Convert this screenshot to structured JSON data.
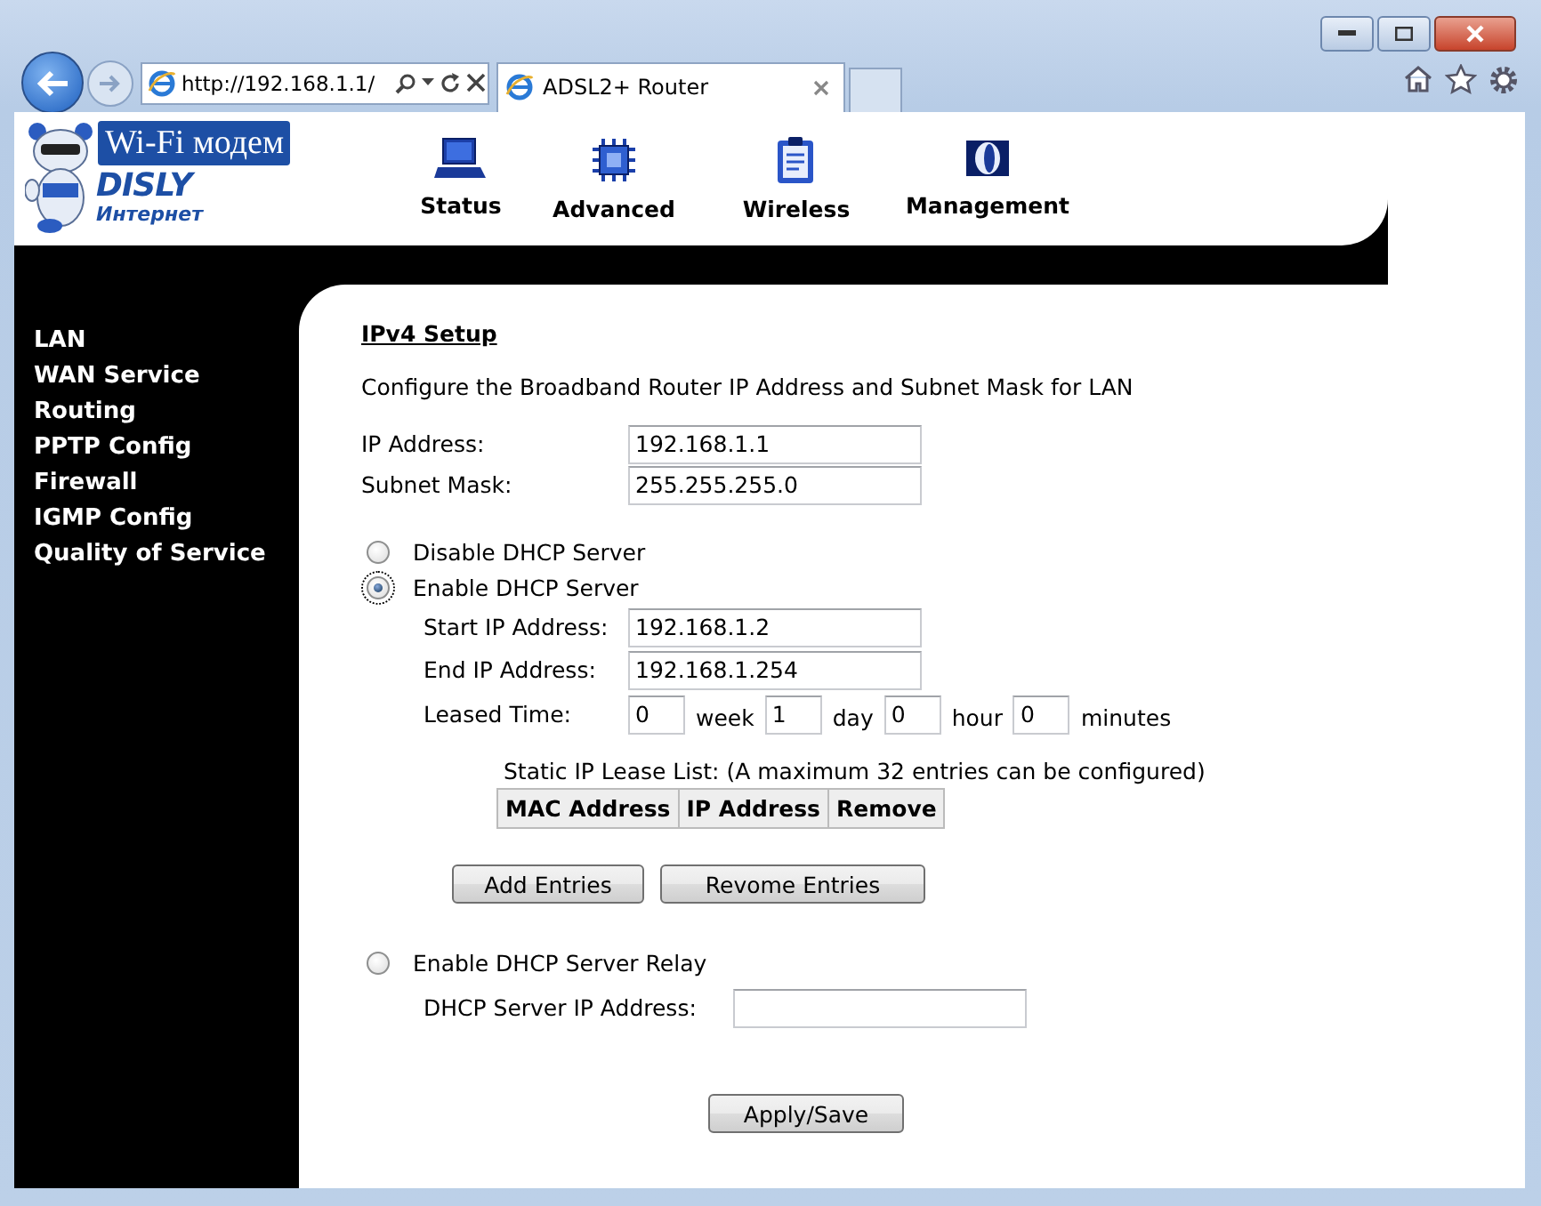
{
  "browser": {
    "address": "http://192.168.1.1/",
    "tab_title": "ADSL2+ Router"
  },
  "logo": {
    "badge": "Wi-Fi модем",
    "brand": "DISLY",
    "subtitle": "Интернет"
  },
  "nav": [
    {
      "label": "Status",
      "kind": "laptop"
    },
    {
      "label": "Advanced",
      "kind": "chip"
    },
    {
      "label": "Wireless",
      "kind": "clipboard"
    },
    {
      "label": "Management",
      "kind": "disc"
    }
  ],
  "sidebar": {
    "items": [
      {
        "label": "LAN"
      },
      {
        "label": "WAN Service"
      },
      {
        "label": "Routing"
      },
      {
        "label": "PPTP Config"
      },
      {
        "label": "Firewall"
      },
      {
        "label": "IGMP Config"
      },
      {
        "label": "Quality of Service"
      }
    ]
  },
  "page": {
    "heading": "IPv4 Setup",
    "description": "Configure the Broadband Router IP Address and Subnet Mask for LAN",
    "fields": [
      {
        "label": "IP Address:",
        "value": "192.168.1.1"
      },
      {
        "label": "Subnet Mask:",
        "value": "255.255.255.0"
      }
    ],
    "dhcp_modes": [
      {
        "label": "Disable DHCP Server",
        "selected": false
      },
      {
        "label": "Enable DHCP Server",
        "selected": true
      },
      {
        "label": "Enable DHCP Server Relay",
        "selected": false
      }
    ],
    "dhcp_server": {
      "range": [
        {
          "label": "Start IP Address:",
          "value": "192.168.1.2"
        },
        {
          "label": "End IP Address:",
          "value": "192.168.1.254"
        }
      ],
      "lease_label": "Leased Time:",
      "lease": [
        {
          "value": "0",
          "unit": "week"
        },
        {
          "value": "1",
          "unit": "day"
        },
        {
          "value": "0",
          "unit": "hour"
        },
        {
          "value": "0",
          "unit": "minutes"
        }
      ],
      "static_caption": "Static IP Lease List: (A maximum 32 entries can be configured)",
      "static_columns": [
        "MAC Address",
        "IP Address",
        "Remove"
      ],
      "buttons": [
        "Add Entries",
        "Revome Entries"
      ]
    },
    "relay": {
      "label": "DHCP Server IP Address:"
    },
    "apply_button": "Apply/Save"
  }
}
